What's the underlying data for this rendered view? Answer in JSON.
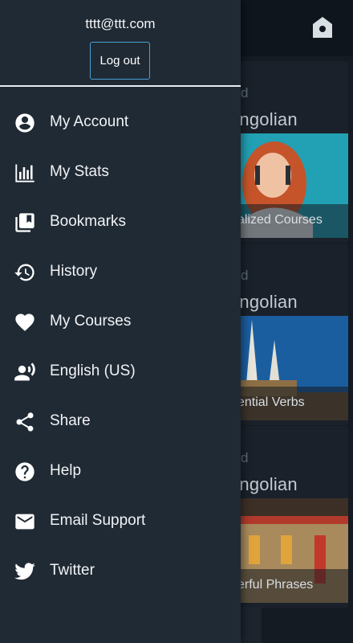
{
  "drawer": {
    "user_email": "tttt@ttt.com",
    "logout_label": "Log out",
    "items": [
      {
        "label": "My Account",
        "icon": "account-circle-icon"
      },
      {
        "label": "My Stats",
        "icon": "bar-chart-icon"
      },
      {
        "label": "Bookmarks",
        "icon": "bookmarks-icon"
      },
      {
        "label": "History",
        "icon": "history-icon"
      },
      {
        "label": "My Courses",
        "icon": "heart-icon"
      },
      {
        "label": "English (US)",
        "icon": "voice-language-icon"
      },
      {
        "label": "Share",
        "icon": "share-icon"
      },
      {
        "label": "Help",
        "icon": "help-icon"
      },
      {
        "label": "Email Support",
        "icon": "email-icon"
      },
      {
        "label": "Twitter",
        "icon": "twitter-icon"
      }
    ]
  },
  "background": {
    "home_icon": "home-icon",
    "cards": [
      {
        "kicker": "d",
        "language": "ongolian",
        "caption": "alized Courses"
      },
      {
        "kicker": "d",
        "language": "ongolian",
        "caption": "ential Verbs"
      },
      {
        "kicker": "d",
        "language": "ongolian",
        "caption": "erful Phrases"
      }
    ]
  },
  "colors": {
    "drawer_bg": "#202a34",
    "app_bg": "#141b23",
    "logout_border": "#4a9fd6",
    "text": "#f1f3f5"
  }
}
